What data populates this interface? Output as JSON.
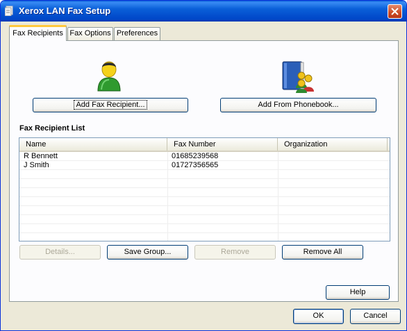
{
  "window": {
    "title": "Xerox LAN Fax Setup"
  },
  "tabs": [
    {
      "label": "Fax Recipients",
      "active": true
    },
    {
      "label": "Fax Options",
      "active": false
    },
    {
      "label": "Preferences",
      "active": false
    }
  ],
  "recipients_tab": {
    "add_fax_recipient_button": "Add Fax Recipient...",
    "add_from_phonebook_button": "Add From Phonebook...",
    "list_title": "Fax Recipient List",
    "columns": [
      "Name",
      "Fax Number",
      "Organization"
    ],
    "rows": [
      {
        "name": "R Bennett",
        "fax_number": "01685239568",
        "organization": ""
      },
      {
        "name": "J Smith",
        "fax_number": "01727356565",
        "organization": ""
      }
    ],
    "details_button": "Details...",
    "save_group_button": "Save Group...",
    "remove_button": "Remove",
    "remove_all_button": "Remove All",
    "help_button": "Help"
  },
  "footer": {
    "ok_button": "OK",
    "cancel_button": "Cancel"
  },
  "icons": {
    "app": "fax-app-icon",
    "close": "close-icon",
    "recipient": "person-icon",
    "phonebook": "phonebook-icon"
  },
  "colors": {
    "titlebar": "#0a5fd8",
    "active_tab_highlight": "#ffc83c",
    "close_button": "#cc4a23",
    "window_bg": "#ece9d8"
  }
}
